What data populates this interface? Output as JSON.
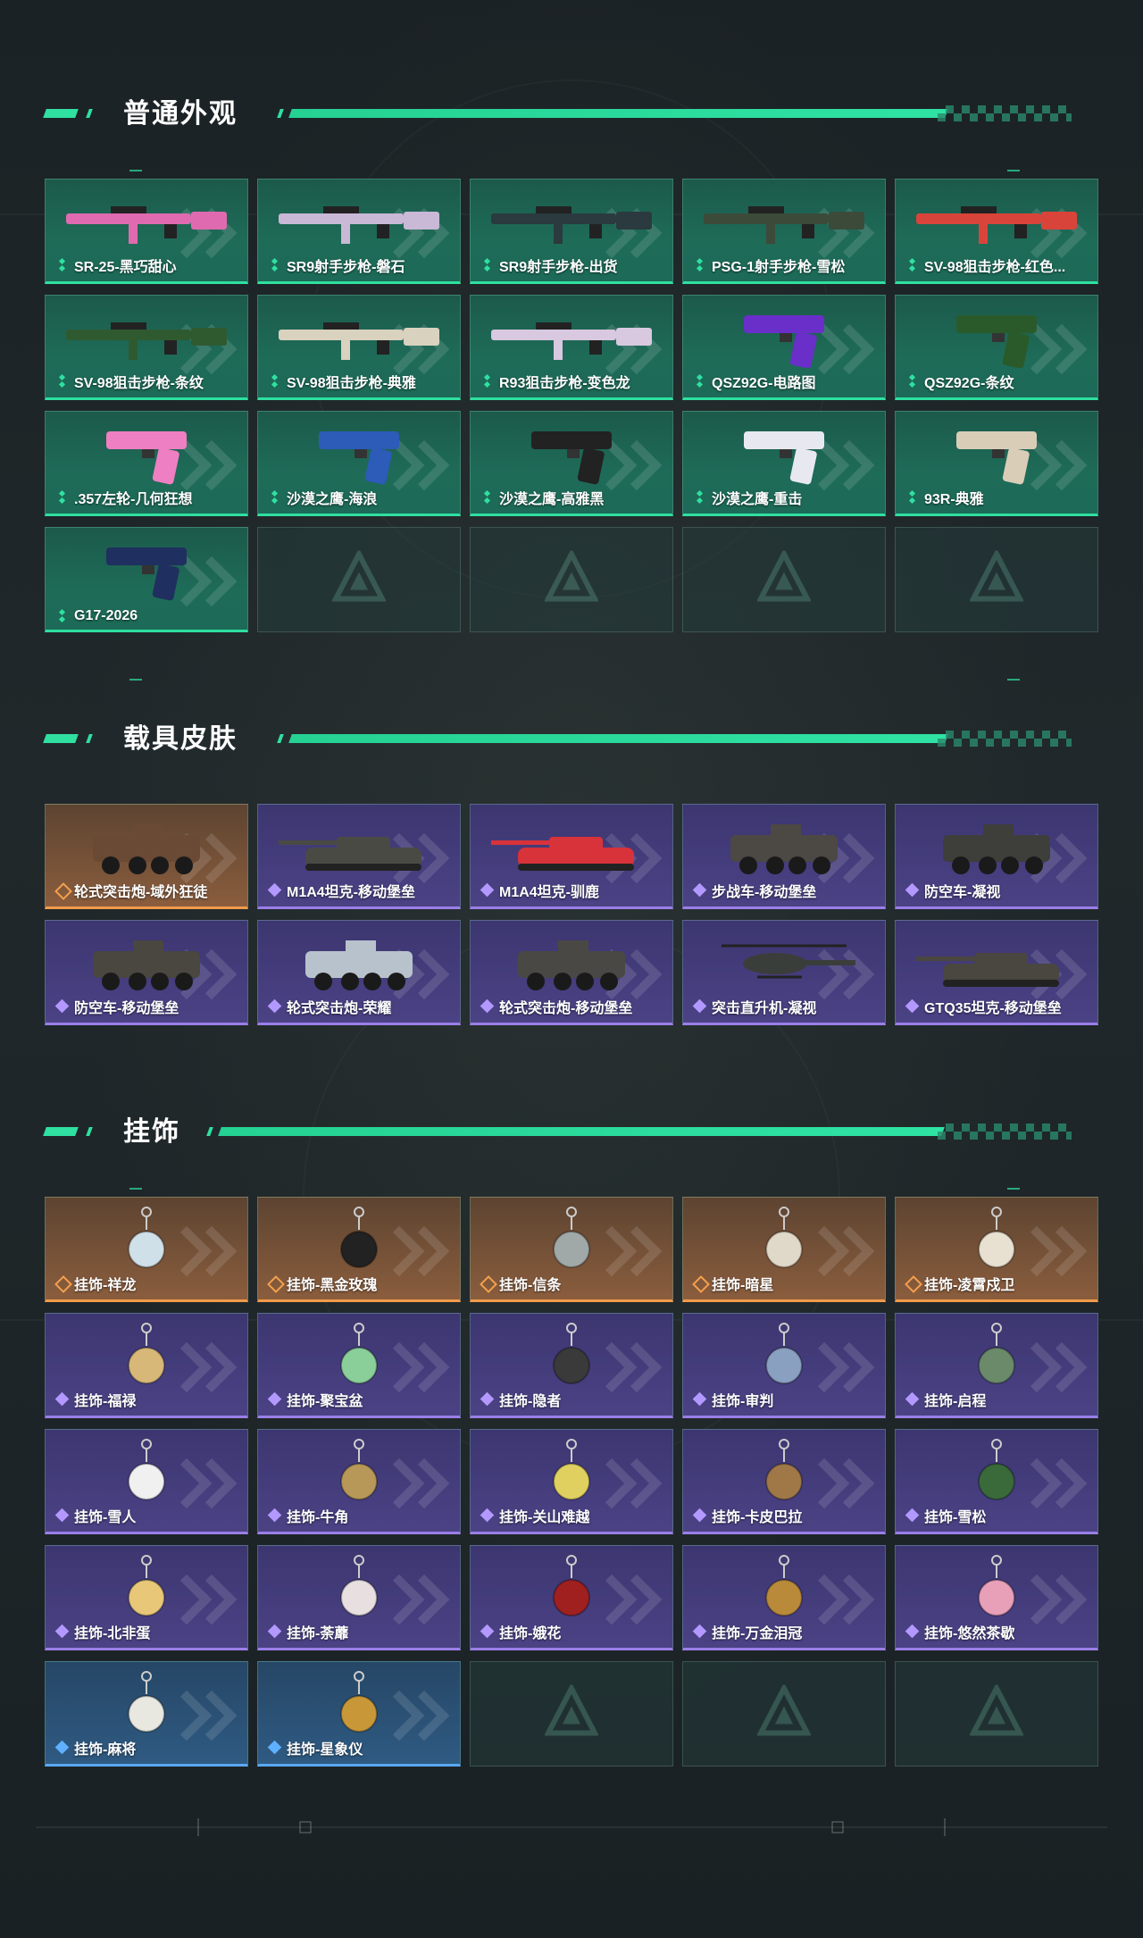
{
  "sections": {
    "weapons": {
      "title": "普通外观",
      "items": [
        {
          "label": "SR-25-黑巧甜心",
          "rarity": "green",
          "icon": "rifle-icon",
          "color": "#e06ab0"
        },
        {
          "label": "SR9射手步枪-磐石",
          "rarity": "green",
          "icon": "rifle-icon",
          "color": "#c9b8d6"
        },
        {
          "label": "SR9射手步枪-出货",
          "rarity": "green",
          "icon": "rifle-icon",
          "color": "#2a3a3e"
        },
        {
          "label": "PSG-1射手步枪-雪松",
          "rarity": "green",
          "icon": "rifle-icon",
          "color": "#3c4a3a"
        },
        {
          "label": "SV-98狙击步枪-红色...",
          "rarity": "green",
          "icon": "sniper-icon",
          "color": "#d9443a"
        },
        {
          "label": "SV-98狙击步枪-条纹",
          "rarity": "green",
          "icon": "sniper-icon",
          "color": "#2f5a2f"
        },
        {
          "label": "SV-98狙击步枪-典雅",
          "rarity": "green",
          "icon": "sniper-icon",
          "color": "#d9d2bf"
        },
        {
          "label": "R93狙击步枪-变色龙",
          "rarity": "green",
          "icon": "sniper-icon",
          "color": "#d8c8e0"
        },
        {
          "label": "QSZ92G-电路图",
          "rarity": "green",
          "icon": "pistol-icon",
          "color": "#6a2ec9"
        },
        {
          "label": "QSZ92G-条纹",
          "rarity": "green",
          "icon": "pistol-icon",
          "color": "#2a5a2a"
        },
        {
          "label": ".357左轮-几何狂想",
          "rarity": "green",
          "icon": "revolver-icon",
          "color": "#ee7fc2"
        },
        {
          "label": "沙漠之鹰-海浪",
          "rarity": "green",
          "icon": "pistol-icon",
          "color": "#2c5bb8"
        },
        {
          "label": "沙漠之鹰-高雅黑",
          "rarity": "green",
          "icon": "pistol-icon",
          "color": "#222222"
        },
        {
          "label": "沙漠之鹰-重击",
          "rarity": "green",
          "icon": "pistol-icon",
          "color": "#e8e8f0"
        },
        {
          "label": "93R-典雅",
          "rarity": "green",
          "icon": "pistol-icon",
          "color": "#d9cdb8"
        },
        {
          "label": "G17-2026",
          "rarity": "green",
          "icon": "pistol-icon",
          "color": "#1f2f5f"
        },
        {
          "empty": true
        },
        {
          "empty": true
        },
        {
          "empty": true
        },
        {
          "empty": true
        }
      ]
    },
    "vehicles": {
      "title": "载具皮肤",
      "items": [
        {
          "label": "轮式突击炮-域外狂徒",
          "rarity": "orange",
          "icon": "armored-car-icon",
          "color": "#6a4a35"
        },
        {
          "label": "M1A4坦克-移动堡垒",
          "rarity": "purple",
          "icon": "tank-icon",
          "color": "#4a4a44"
        },
        {
          "label": "M1A4坦克-驯鹿",
          "rarity": "purple",
          "icon": "tank-icon",
          "color": "#d8323a"
        },
        {
          "label": "步战车-移动堡垒",
          "rarity": "purple",
          "icon": "apc-icon",
          "color": "#4c4844"
        },
        {
          "label": "防空车-凝视",
          "rarity": "purple",
          "icon": "apc-icon",
          "color": "#3e3e3a"
        },
        {
          "label": "防空车-移动堡垒",
          "rarity": "purple",
          "icon": "apc-icon",
          "color": "#4a4640"
        },
        {
          "label": "轮式突击炮-荣耀",
          "rarity": "purple",
          "icon": "armored-car-icon",
          "color": "#b8c2cc"
        },
        {
          "label": "轮式突击炮-移动堡垒",
          "rarity": "purple",
          "icon": "armored-car-icon",
          "color": "#4a4844"
        },
        {
          "label": "突击直升机-凝视",
          "rarity": "purple",
          "icon": "helicopter-icon",
          "color": "#3a3e3a"
        },
        {
          "label": "GTQ35坦克-移动堡垒",
          "rarity": "purple",
          "icon": "tank-icon",
          "color": "#4a4640"
        }
      ]
    },
    "charms": {
      "title": "挂饰",
      "items": [
        {
          "label": "挂饰-祥龙",
          "rarity": "orange",
          "icon": "dragon-charm-icon",
          "color": "#cfe0e8"
        },
        {
          "label": "挂饰-黑金玫瑰",
          "rarity": "orange",
          "icon": "rose-charm-icon",
          "color": "#222222"
        },
        {
          "label": "挂饰-信条",
          "rarity": "orange",
          "icon": "blade-charm-icon",
          "color": "#a0a8a8"
        },
        {
          "label": "挂饰-暗星",
          "rarity": "orange",
          "icon": "bird-charm-icon",
          "color": "#e0d8c8"
        },
        {
          "label": "挂饰-凌霄戍卫",
          "rarity": "orange",
          "icon": "penguin-charm-icon",
          "color": "#e8e0d0"
        },
        {
          "label": "挂饰-福禄",
          "rarity": "purple",
          "icon": "gourd-charm-icon",
          "color": "#d8b878"
        },
        {
          "label": "挂饰-聚宝盆",
          "rarity": "purple",
          "icon": "treasure-charm-icon",
          "color": "#8acf9a"
        },
        {
          "label": "挂饰-隐者",
          "rarity": "purple",
          "icon": "card-charm-icon",
          "color": "#3a3a3a"
        },
        {
          "label": "挂饰-审判",
          "rarity": "purple",
          "icon": "card-charm-icon",
          "color": "#8aa0c0"
        },
        {
          "label": "挂饰-启程",
          "rarity": "purple",
          "icon": "compass-charm-icon",
          "color": "#6a8a6a"
        },
        {
          "label": "挂饰-雪人",
          "rarity": "purple",
          "icon": "snowman-charm-icon",
          "color": "#f0f0f0"
        },
        {
          "label": "挂饰-牛角",
          "rarity": "purple",
          "icon": "horn-charm-icon",
          "color": "#b89858"
        },
        {
          "label": "挂饰-关山难越",
          "rarity": "purple",
          "icon": "cylinder-charm-icon",
          "color": "#e0d060"
        },
        {
          "label": "挂饰-卡皮巴拉",
          "rarity": "purple",
          "icon": "capybara-charm-icon",
          "color": "#a07848"
        },
        {
          "label": "挂饰-雪松",
          "rarity": "purple",
          "icon": "tree-charm-icon",
          "color": "#3a6a3a"
        },
        {
          "label": "挂饰-北非蛋",
          "rarity": "purple",
          "icon": "egg-charm-icon",
          "color": "#e8c878"
        },
        {
          "label": "挂饰-荼蘼",
          "rarity": "purple",
          "icon": "flower-charm-icon",
          "color": "#e8e0e0"
        },
        {
          "label": "挂饰-娥花",
          "rarity": "purple",
          "icon": "flower-charm-icon",
          "color": "#a02020"
        },
        {
          "label": "挂饰-万金泪冠",
          "rarity": "purple",
          "icon": "burger-charm-icon",
          "color": "#b88a3a"
        },
        {
          "label": "挂饰-悠然茶歇",
          "rarity": "purple",
          "icon": "cupcake-charm-icon",
          "color": "#e8a0b8"
        },
        {
          "label": "挂饰-麻将",
          "rarity": "blue",
          "icon": "mahjong-charm-icon",
          "color": "#e8e8e0"
        },
        {
          "label": "挂饰-星象仪",
          "rarity": "blue",
          "icon": "astrolabe-charm-icon",
          "color": "#c89838"
        },
        {
          "empty": true
        },
        {
          "empty": true
        },
        {
          "empty": true
        }
      ]
    }
  },
  "colors": {
    "accent": "#2fe0a0",
    "green": "#1e6b58",
    "purple": "#4b4285",
    "orange": "#8a5d3d",
    "blue": "#2f5a82"
  }
}
